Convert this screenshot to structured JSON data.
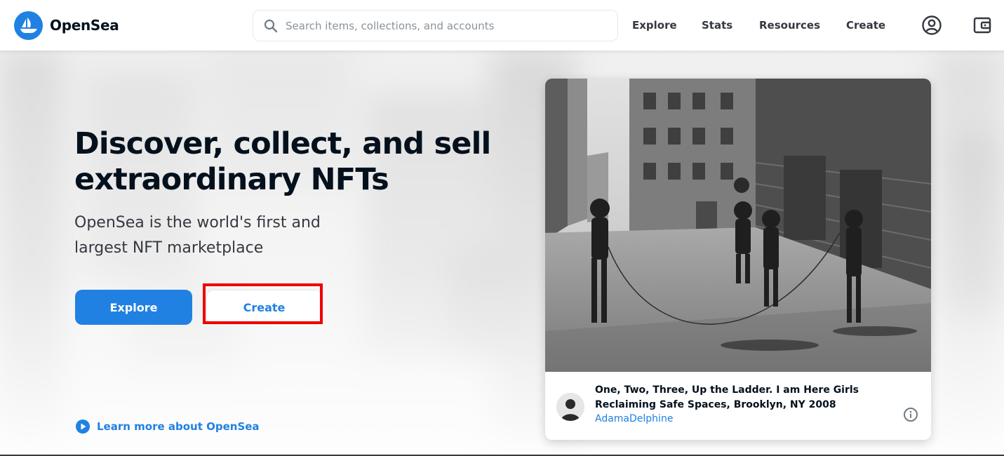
{
  "brand": {
    "name": "OpenSea",
    "color": "#2081e2"
  },
  "nav": {
    "search_placeholder": "Search items, collections, and accounts",
    "links": [
      "Explore",
      "Stats",
      "Resources",
      "Create"
    ],
    "icons": [
      "account-icon",
      "wallet-icon"
    ]
  },
  "hero": {
    "title": "Discover, collect, and sell extraordinary NFTs",
    "subtitle": "OpenSea is the world's first and largest NFT marketplace",
    "explore_label": "Explore",
    "create_label": "Create",
    "learn_more": "Learn more about OpenSea"
  },
  "featured": {
    "title": "One, Two, Three, Up the Ladder. I am Here Girls Reclaiming Safe Spaces, Brooklyn, NY 2008",
    "creator": "AdamaDelphine",
    "info_icon": "info-icon"
  },
  "colors": {
    "accent": "#2081e2",
    "highlight": "#ee0000",
    "text": "#04111d"
  }
}
